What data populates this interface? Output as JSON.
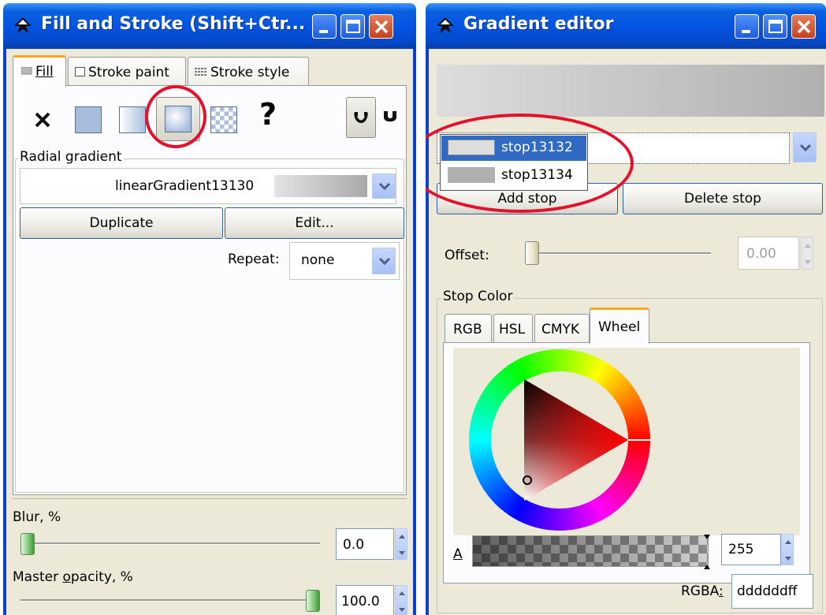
{
  "fill_stroke_window": {
    "title": "Fill and Stroke (Shift+Ctr...",
    "tabs": [
      {
        "label": "Fill",
        "active": true
      },
      {
        "label": "Stroke paint",
        "active": false
      },
      {
        "label": "Stroke style",
        "active": false
      }
    ],
    "paint_types": [
      "no-paint",
      "flat-color",
      "linear-gradient",
      "radial-gradient",
      "pattern",
      "unset"
    ],
    "selected_paint_type": "radial-gradient",
    "unset_glyph": "?",
    "section_label": "Radial gradient",
    "gradient_name": "linearGradient13130",
    "duplicate_label": "Duplicate",
    "edit_label": "Edit...",
    "repeat_label": "Repeat:",
    "repeat_value": "none",
    "blur_label": "Blur, %",
    "blur_value": "0.0",
    "blur_fraction": 0.0,
    "opacity_label": "Master opacity, %",
    "opacity_value": "100.0",
    "opacity_fraction": 1.0
  },
  "gradient_editor_window": {
    "title": "Gradient editor",
    "stops": [
      {
        "name": "stop13132",
        "color": "#dddddd",
        "selected": true
      },
      {
        "name": "stop13134",
        "color": "#b0b0b0",
        "selected": false
      }
    ],
    "add_stop_label": "Add stop",
    "delete_stop_label": "Delete stop",
    "offset_label": "Offset:",
    "offset_value": "0.00",
    "offset_fraction": 0.0,
    "stop_color_label": "Stop Color",
    "color_tabs": [
      {
        "label": "RGB",
        "active": false
      },
      {
        "label": "HSL",
        "active": false
      },
      {
        "label": "CMYK",
        "active": false
      },
      {
        "label": "Wheel",
        "active": true
      }
    ],
    "alpha_label": "A",
    "alpha_value": "255",
    "rgba_label": "RGBA:",
    "rgba_value": "ddddddff"
  },
  "colors": {
    "titlebar": "#0554e3",
    "window_bg": "#ece9d8",
    "selection": "#316ac5",
    "highlight_ring": "#e3122a"
  }
}
